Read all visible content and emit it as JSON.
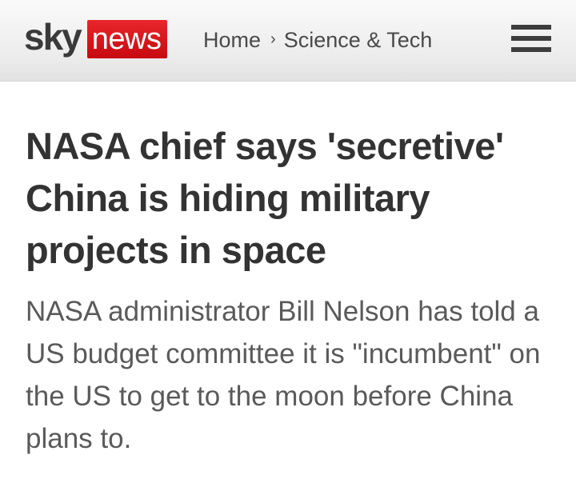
{
  "header": {
    "logo": {
      "sky_text": "sky",
      "news_text": "news"
    },
    "breadcrumb": {
      "home_label": "Home",
      "separator": "›",
      "section_label": "Science & Tech"
    },
    "menu_icon": "hamburger-menu-icon"
  },
  "article": {
    "headline": "NASA chief says 'secretive' China is hiding military projects in space",
    "standfirst": "NASA administrator Bill Nelson has told a US budget committee it is \"incumbent\" on the US to get to the moon before China plans to."
  },
  "colors": {
    "brand_red": "#c70a10",
    "logo_grey": "#3a3a3a",
    "headline": "#333333",
    "standfirst": "#5a5a5a",
    "header_bg": "#ececec"
  }
}
